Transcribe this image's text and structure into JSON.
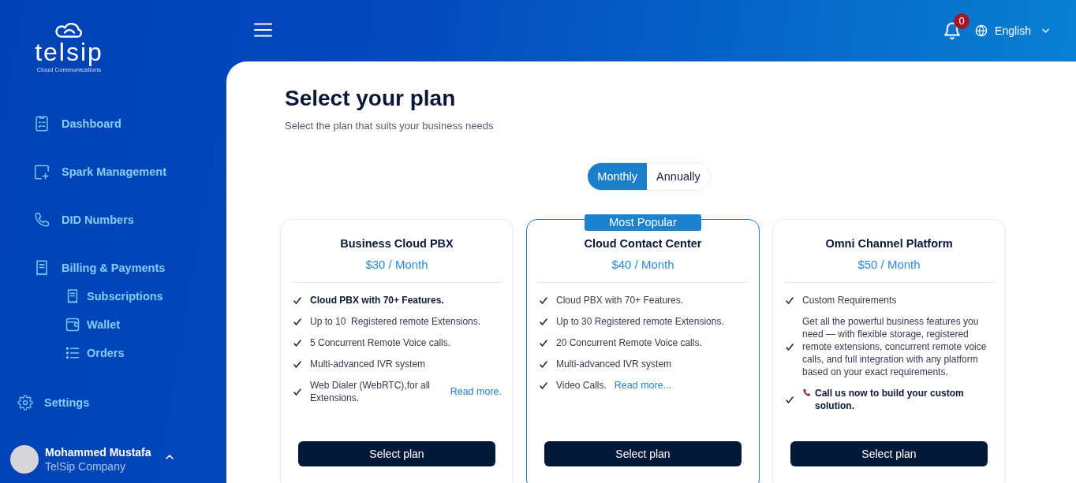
{
  "sidebar": {
    "logo": {
      "name": "telsip",
      "tagline": "Cloud Communications"
    },
    "items": [
      {
        "label": "Dashboard"
      },
      {
        "label": "Spark Management"
      },
      {
        "label": "DID Numbers"
      },
      {
        "label": "Billing & Payments",
        "children": [
          {
            "label": "Subscriptions"
          },
          {
            "label": "Wallet"
          },
          {
            "label": "Orders"
          }
        ]
      }
    ],
    "settings": {
      "label": "Settings"
    },
    "user": {
      "name": "Mohammed Mustafa",
      "company": "TelSip Company"
    }
  },
  "header": {
    "notifications": {
      "count": "0"
    },
    "language": "English"
  },
  "page": {
    "title": "Select your plan",
    "subtitle": "Select the plan that suits your business needs"
  },
  "billing_toggle": [
    {
      "label": "Monthly",
      "selected": true
    },
    {
      "label": "Annually",
      "selected": false
    }
  ],
  "plans": [
    {
      "name": "Business Cloud PBX",
      "price": "$30 / Month",
      "highlighted": false,
      "features": [
        {
          "kind": "plain",
          "text": "Cloud PBX with 70+ Features.",
          "bold": true
        },
        {
          "kind": "plain",
          "text": "Up to 10  Registered remote Extensions.",
          "bold": false
        },
        {
          "kind": "plain",
          "text": "5 Concurrent Remote Voice calls.",
          "bold": false
        },
        {
          "kind": "plain",
          "text": "Multi-advanced IVR system",
          "bold": false
        },
        {
          "kind": "plain",
          "text": "Web Dialer (WebRTC),for all Extensions.",
          "bold": false,
          "link": "Read more."
        }
      ],
      "button": "Select plan"
    },
    {
      "name": "Cloud Contact Center",
      "price": "$40 / Month",
      "highlighted": true,
      "badge": "Most Popular",
      "features": [
        {
          "kind": "plain",
          "text": "Cloud PBX with 70+ Features.",
          "bold": false
        },
        {
          "kind": "plain",
          "text": "Up to 30 Registered remote Extensions.",
          "bold": false
        },
        {
          "kind": "plain",
          "text": "20 Concurrent Remote Voice calls.",
          "bold": false
        },
        {
          "kind": "plain",
          "text": "Multi-advanced IVR system",
          "bold": false
        },
        {
          "kind": "plain",
          "text": "Video Calls.",
          "bold": false,
          "link": "Read more..."
        }
      ],
      "button": "Select plan"
    },
    {
      "name": "Omni Channel Platform",
      "price": "$50 / Month",
      "highlighted": false,
      "features": [
        {
          "kind": "plain",
          "text": "Custom Requirements",
          "bold": false
        },
        {
          "kind": "plain",
          "text": "Get all the powerful business features you need — with flexible storage, registered remote extensions, concurrent remote voice calls, and full integration with any platform based on your exact requirements.",
          "bold": false
        },
        {
          "kind": "call",
          "text": "Call us now to build your custom solution.",
          "bold": true
        }
      ],
      "button": "Select plan"
    }
  ]
}
